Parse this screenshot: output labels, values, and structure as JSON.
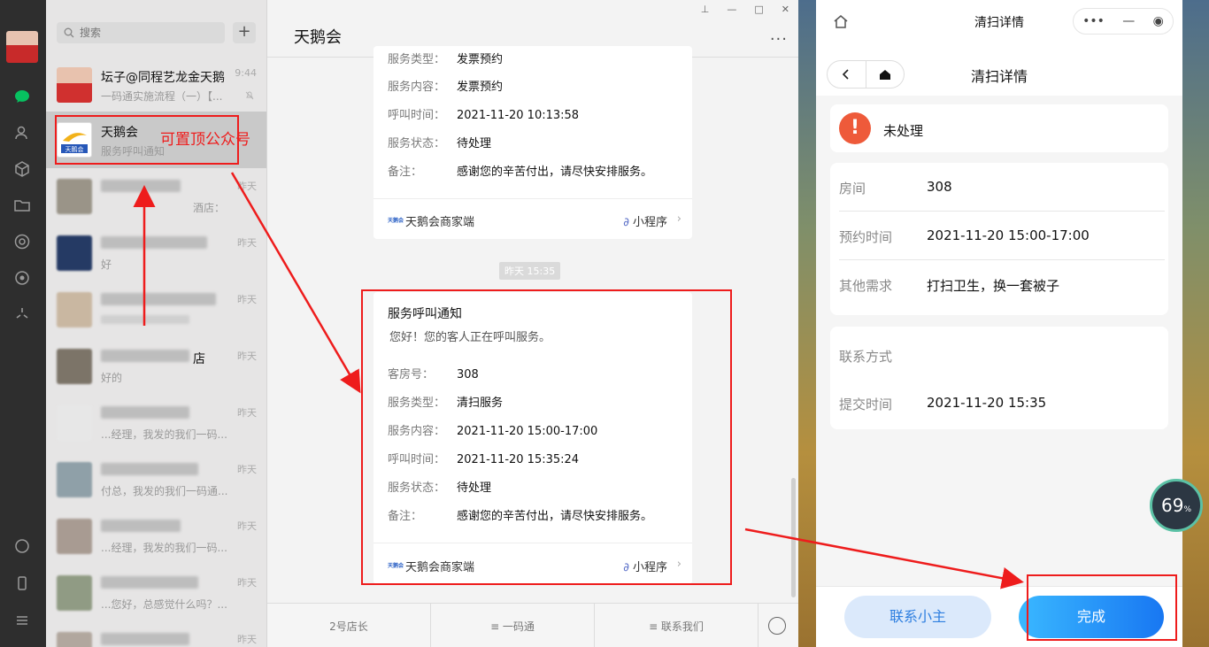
{
  "sidebar": {
    "icons": [
      "chat-icon",
      "contacts-icon",
      "collections-icon",
      "files-icon",
      "moments-icon",
      "mini-programs-icon",
      "look-icon",
      "phone-icon",
      "menu-icon"
    ]
  },
  "chat_list": {
    "search_placeholder": "搜索",
    "add_label": "+",
    "items": [
      {
        "name": "坛子@同程艺龙金天鹅",
        "preview": "一码通实施流程（一）【...",
        "time": "9:44"
      },
      {
        "name": "天鹅会",
        "preview": "服务呼叫通知",
        "time": ""
      },
      {
        "name": "",
        "preview": "酒店：",
        "time": "昨天"
      },
      {
        "name": "",
        "preview": "好",
        "time": "昨天"
      },
      {
        "name": "",
        "preview": "",
        "time": "昨天"
      },
      {
        "name": "店",
        "preview": "好的",
        "time": "昨天"
      },
      {
        "name": "",
        "preview": "...经理，我发的我们一码...",
        "time": "昨天"
      },
      {
        "name": "",
        "preview": "付总，我发的我们一码通...",
        "time": "昨天"
      },
      {
        "name": "",
        "preview": "...经理，我发的我们一码...",
        "time": "昨天"
      },
      {
        "name": "",
        "preview": "...您好，总感觉什么吗？...",
        "time": "昨天"
      },
      {
        "name": "",
        "preview": "",
        "time": "昨天"
      }
    ],
    "logo_text": "天鹅会"
  },
  "chat": {
    "title": "天鹅会",
    "window_controls": [
      "⊥",
      "—",
      "□",
      "✕"
    ],
    "more": "···",
    "card1": {
      "rows": [
        {
          "k": "服务类型：",
          "v": "发票预约"
        },
        {
          "k": "服务内容：",
          "v": "发票预约"
        },
        {
          "k": "呼叫时间：",
          "v": "2021-11-20 10:13:58"
        },
        {
          "k": "服务状态：",
          "v": "待处理"
        },
        {
          "k": "备注：",
          "v": "感谢您的辛苦付出，请尽快安排服务。"
        }
      ],
      "source": "天鹅会商家端",
      "mini": "小程序",
      "logo": "天鹅会"
    },
    "timestamp": "昨天 15:35",
    "card2": {
      "title": "服务呼叫通知",
      "greeting": "您好！您的客人正在呼叫服务。",
      "rows": [
        {
          "k": "客房号：",
          "v": "308"
        },
        {
          "k": "服务类型：",
          "v": "清扫服务"
        },
        {
          "k": "服务内容：",
          "v": "2021-11-20  15:00-17:00"
        },
        {
          "k": "呼叫时间：",
          "v": "2021-11-20 15:35:24"
        },
        {
          "k": "服务状态：",
          "v": "待处理"
        },
        {
          "k": "备注：",
          "v": "感谢您的辛苦付出，请尽快安排服务。"
        }
      ],
      "source": "天鹅会商家端",
      "mini": "小程序",
      "logo": "天鹅会"
    },
    "bottom_menu": [
      "2号店长",
      "≡ 一码通",
      "≡ 联系我们"
    ]
  },
  "mini_program": {
    "window_title": "清扫详情",
    "nav_title": "清扫详情",
    "status": "未处理",
    "status_icon": "!",
    "details": [
      {
        "k": "房间",
        "v": "308"
      },
      {
        "k": "预约时间",
        "v": "2021-11-20 15:00-17:00"
      },
      {
        "k": "其他需求",
        "v": "打扫卫生，换一套被子"
      }
    ],
    "contact": [
      {
        "k": "联系方式",
        "v": ""
      },
      {
        "k": "提交时间",
        "v": "2021-11-20 15:35"
      }
    ],
    "btn_contact": "联系小主",
    "btn_done": "完成"
  },
  "gauge": {
    "value": "69",
    "unit": "%"
  },
  "annotation": {
    "label": "可置顶公众号"
  },
  "colors": {
    "accent": "#1877f2",
    "danger": "#ee5a3a",
    "annotation": "#ee1c1c",
    "wechat_green": "#07c160"
  }
}
